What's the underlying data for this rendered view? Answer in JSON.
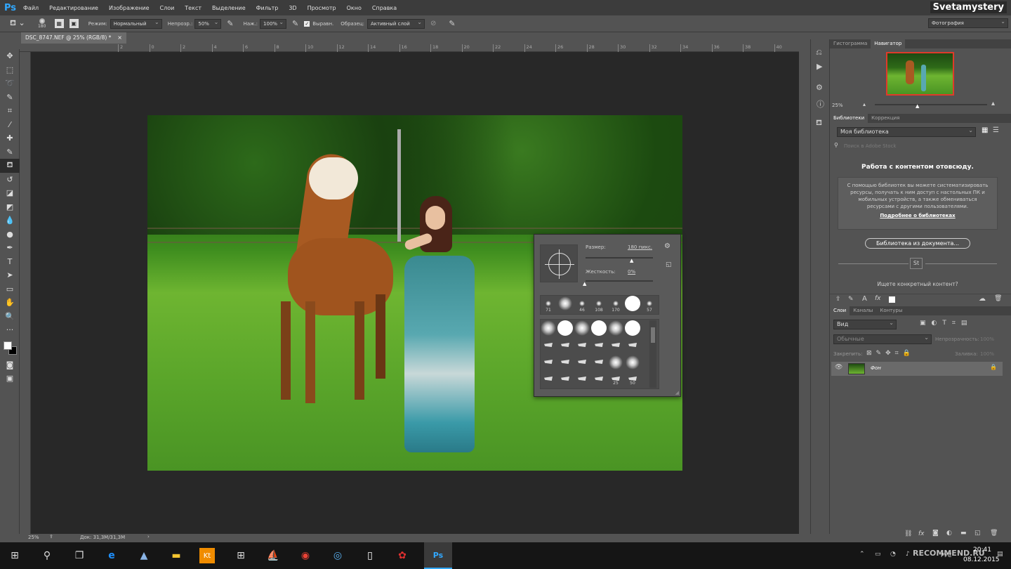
{
  "app": {
    "logo": "Ps",
    "user": "Svetamystery"
  },
  "menu": [
    "Файл",
    "Редактирование",
    "Изображение",
    "Слои",
    "Текст",
    "Выделение",
    "Фильтр",
    "3D",
    "Просмотр",
    "Окно",
    "Справка"
  ],
  "options": {
    "brush_size": "180",
    "mode_label": "Режим:",
    "mode_value": "Нормальный",
    "opacity_label": "Непрозр.:",
    "opacity_value": "50%",
    "flow_label": "Наж.:",
    "flow_value": "100%",
    "aligned_label": "Выравн.",
    "sample_label": "Образец:",
    "sample_value": "Активный слой",
    "workspace": "Фотография"
  },
  "document": {
    "tab_title": "DSC_8747.NEF @ 25% (RGB/8) *",
    "zoom": "25%",
    "doc_size": "Док: 31,3M/31,3M"
  },
  "ruler": {
    "top": [
      "2",
      "0",
      "2",
      "4",
      "6",
      "8",
      "10",
      "12",
      "14",
      "16",
      "18",
      "20",
      "22",
      "24",
      "26",
      "28",
      "30",
      "32",
      "34",
      "36",
      "38",
      "40"
    ]
  },
  "brush_popup": {
    "size_label": "Размер:",
    "size_value": "180 пикс.",
    "hardness_label": "Жесткость:",
    "hardness_value": "0%",
    "row1": [
      "71",
      "",
      "46",
      "108",
      "170",
      "",
      "57"
    ],
    "row4": [
      "",
      "",
      "",
      "",
      "25",
      "50",
      ""
    ]
  },
  "navigator": {
    "tabs": [
      "Гистограмма",
      "Навигатор"
    ],
    "zoom": "25%"
  },
  "libraries": {
    "tabs": [
      "Библиотеки",
      "Коррекция"
    ],
    "library": "Моя библиотека",
    "search_placeholder": "Поиск в Adobe Stock",
    "heading": "Работа с контентом отовсюду.",
    "body": "С помощью библиотек вы можете систематизировать ресурсы, получать к ним доступ с настольных ПК и мобильных устройств, а также обмениваться ресурсами с другими пользователями.",
    "link": "Подробнее о библиотеках",
    "doc_button": "Библиотека из документа...",
    "stock_badge": "St",
    "looking": "Ищете конкретный контент?"
  },
  "layers": {
    "tabs": [
      "Слои",
      "Каналы",
      "Контуры"
    ],
    "filter": "Вид",
    "blend": "Обычные",
    "opacity_label": "Непрозрачность:",
    "opacity_value": "100%",
    "lock_label": "Закрепить:",
    "fill_label": "Заливка:",
    "fill_value": "100%",
    "layer_name": "Фон"
  },
  "taskbar": {
    "time": "20:41",
    "date": "08.12.2015",
    "lang": "РУС",
    "watermark": "RECOMMEND.RU"
  },
  "colors": {
    "accent": "#31a8ff",
    "panel": "#535353",
    "canvas": "#282828"
  }
}
